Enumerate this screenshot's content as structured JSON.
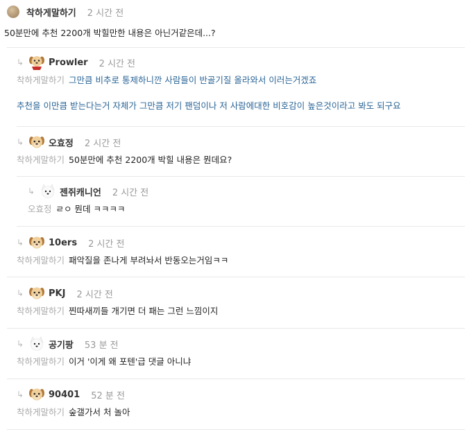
{
  "root": {
    "author": "착하게말하기",
    "time": "2 시간 전",
    "text": "50분만에 추천 2200개 박힐만한 내용은 아닌거같은데...?"
  },
  "replies": [
    {
      "author": "Prowler",
      "time": "2 시간 전",
      "mention": "착하게말하기",
      "text": "그만큼 비추로 통제하니깐 사람들이 반골기질 올라와서 이러는거겠죠",
      "text2": "추천을 이만큼 받는다는거 자체가 그만큼 저기 팬덤이나 저 사람에대한 비호감이 높은것이라고 봐도 되구요",
      "avatar": "puppy-icon"
    },
    {
      "author": "오효정",
      "time": "2 시간 전",
      "mention": "착하게말하기",
      "text": "50분만에 추천 2200개 박힐 내용은 뭔데요?",
      "avatar": "puppy-icon"
    },
    {
      "author": "젠쥐캐니언",
      "time": "2 시간 전",
      "mention": "오효정",
      "text": "ㄹㅇ 뭔데 ㅋㅋㅋㅋ",
      "avatar": "white-dog-icon"
    },
    {
      "author": "10ers",
      "time": "2 시간 전",
      "mention": "착하게말하기",
      "text": "패악질을 존나게 부려놔서 반동오는거임ㅋㅋ",
      "avatar": "puppy-icon"
    },
    {
      "author": "PKJ",
      "time": "2 시간 전",
      "mention": "착하게말하기",
      "text": "찐따새끼들 개기면 더 패는 그런 느낌이지",
      "avatar": "puppy-icon"
    },
    {
      "author": "공기팡",
      "time": "53 분 전",
      "mention": "착하게말하기",
      "text": "이거 '이게 왜 포텐'급 댓글 아니냐",
      "avatar": "white-dog-icon"
    },
    {
      "author": "90401",
      "time": "52 분 전",
      "mention": "착하게말하기",
      "text": "숲갤가서 처 놀아",
      "avatar": "puppy-icon"
    }
  ],
  "colors": {
    "mention": "#aaaaaa",
    "blue_text": "#2a6496",
    "divider": "#e8e8e8"
  }
}
